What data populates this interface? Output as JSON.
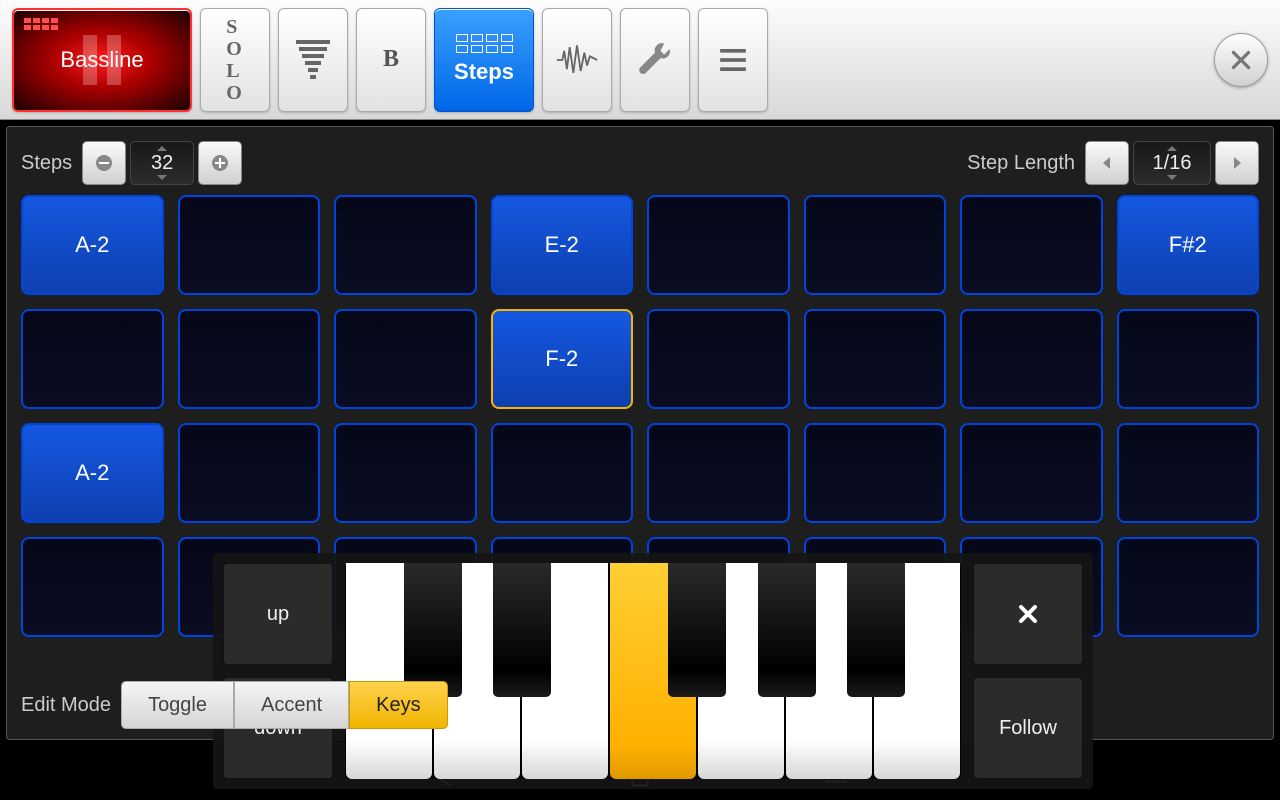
{
  "toolbar": {
    "bassline_label": "Bassline",
    "solo_label": "SOLO",
    "b_label": "B",
    "steps_label": "Steps"
  },
  "controls": {
    "steps_label": "Steps",
    "steps_value": "32",
    "step_length_label": "Step Length",
    "step_length_value": "1/16"
  },
  "grid": {
    "cells": [
      {
        "note": "A-2",
        "active": true
      },
      {
        "note": "",
        "active": false
      },
      {
        "note": "",
        "active": false
      },
      {
        "note": "E-2",
        "active": true
      },
      {
        "note": "",
        "active": false
      },
      {
        "note": "",
        "active": false
      },
      {
        "note": "",
        "active": false
      },
      {
        "note": "F#2",
        "active": true
      },
      {
        "note": "",
        "active": false
      },
      {
        "note": "",
        "active": false
      },
      {
        "note": "",
        "active": false
      },
      {
        "note": "F-2",
        "active": true,
        "selected": true
      },
      {
        "note": "",
        "active": false
      },
      {
        "note": "",
        "active": false
      },
      {
        "note": "",
        "active": false
      },
      {
        "note": "",
        "active": false
      },
      {
        "note": "A-2",
        "active": true
      },
      {
        "note": "",
        "active": false
      },
      {
        "note": "",
        "active": false
      },
      {
        "note": "",
        "active": false
      },
      {
        "note": "",
        "active": false
      },
      {
        "note": "",
        "active": false
      },
      {
        "note": "",
        "active": false
      },
      {
        "note": "",
        "active": false
      },
      {
        "note": "",
        "active": false
      },
      {
        "note": "",
        "active": false
      },
      {
        "note": "",
        "active": false
      },
      {
        "note": "",
        "active": false
      },
      {
        "note": "",
        "active": false
      },
      {
        "note": "",
        "active": false
      },
      {
        "note": "",
        "active": false
      },
      {
        "note": "",
        "active": false
      }
    ]
  },
  "keyboard": {
    "up_label": "up",
    "down_label": "down",
    "follow_label": "Follow",
    "highlighted_white_key_index": 3,
    "black_key_positions_pct": [
      9.5,
      24,
      52.5,
      67,
      81.5
    ]
  },
  "edit_mode": {
    "label": "Edit Mode",
    "toggle": "Toggle",
    "accent": "Accent",
    "keys": "Keys",
    "active": "keys"
  }
}
